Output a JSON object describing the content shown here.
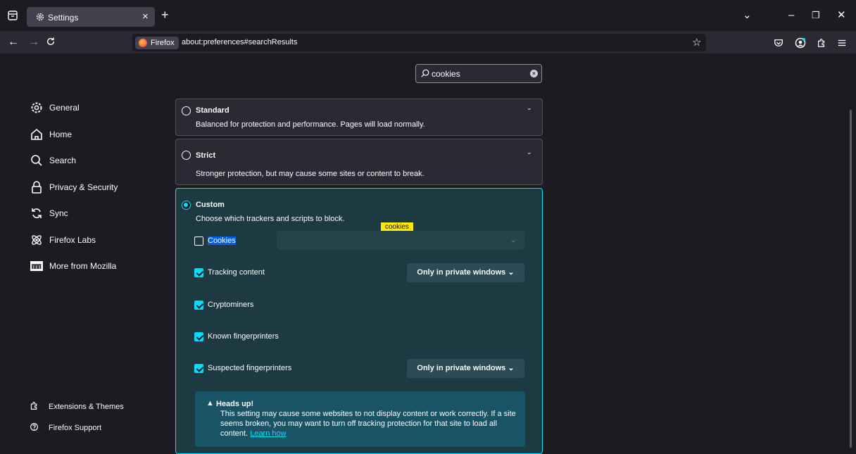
{
  "tab": {
    "title": "Settings",
    "close": "×"
  },
  "newtab": "+",
  "window": {
    "list": "⌄",
    "minimize": "–",
    "restore": "❐",
    "close": "✕"
  },
  "nav": {
    "back": "←",
    "forward": "→",
    "reload": "C"
  },
  "urlbar": {
    "identity": "Firefox",
    "url": "about:preferences#searchResults"
  },
  "search": {
    "value": "cookies"
  },
  "sidebar": {
    "items": [
      {
        "label": "General",
        "icon": "gear-icon"
      },
      {
        "label": "Home",
        "icon": "home-icon"
      },
      {
        "label": "Search",
        "icon": "search-icon"
      },
      {
        "label": "Privacy & Security",
        "icon": "lock-icon"
      },
      {
        "label": "Sync",
        "icon": "sync-icon"
      },
      {
        "label": "Firefox Labs",
        "icon": "labs-icon"
      },
      {
        "label": "More from Mozilla",
        "icon": "mozilla-icon"
      }
    ],
    "footer": [
      {
        "label": "Extensions & Themes",
        "icon": "puzzle-icon"
      },
      {
        "label": "Firefox Support",
        "icon": "help-icon"
      }
    ]
  },
  "standard": {
    "title": "Standard",
    "desc": "Balanced for protection and performance. Pages will load normally."
  },
  "strict": {
    "title": "Strict",
    "desc": "Stronger protection, but may cause some sites or content to break."
  },
  "custom": {
    "title": "Custom",
    "desc": "Choose which trackers and scripts to block.",
    "tooltip": "cookies",
    "options": [
      {
        "label": "Cookies",
        "checked": false
      },
      {
        "label": "Tracking content",
        "checked": true,
        "select": "Only in private windows"
      },
      {
        "label": "Cryptominers",
        "checked": true
      },
      {
        "label": "Known fingerprinters",
        "checked": true
      },
      {
        "label": "Suspected fingerprinters",
        "checked": true,
        "select": "Only in private windows"
      }
    ]
  },
  "notice": {
    "title": "Heads up!",
    "text": "This setting may cause some websites to not display content or work correctly. If a site seems broken, you may want to turn off tracking protection for that site to load all content.",
    "link": "Learn how"
  },
  "colors": {
    "accent": "#00ddff",
    "background": "#1c1b22",
    "card": "#2b2a33",
    "notice": "#185465",
    "tooltip": "#ffe900"
  }
}
